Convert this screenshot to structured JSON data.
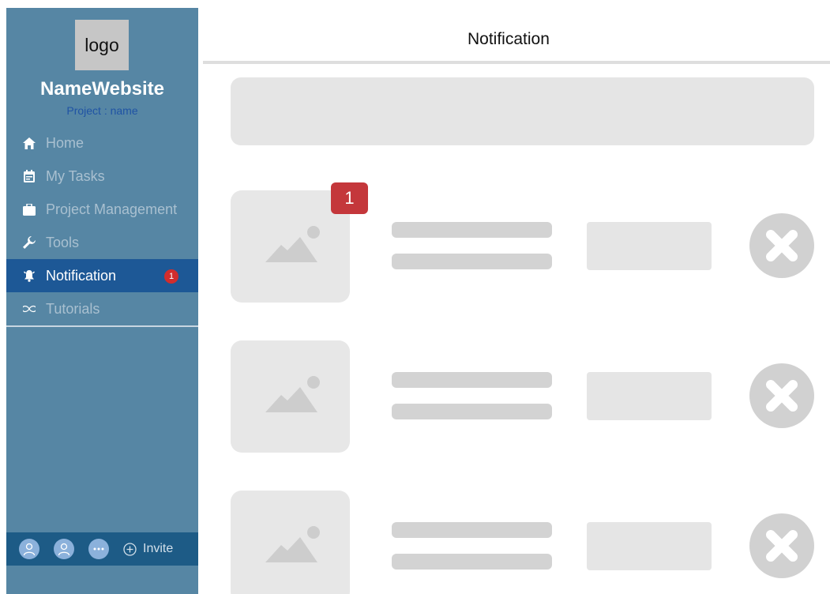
{
  "sidebar": {
    "logo_text": "logo",
    "site_name": "NameWebsite",
    "project_label": "Project : name",
    "nav": [
      {
        "label": "Home",
        "icon": "home-icon"
      },
      {
        "label": "My Tasks",
        "icon": "calendar-icon"
      },
      {
        "label": "Project Management",
        "icon": "briefcase-icon"
      },
      {
        "label": "Tools",
        "icon": "wrench-icon"
      },
      {
        "label": "Notification",
        "icon": "bell-icon",
        "badge": "1",
        "active": true
      },
      {
        "label": "Tutorials",
        "icon": "infinity-icon"
      }
    ],
    "invite": {
      "label": "Invite",
      "avatars": [
        "user-avatar-icon",
        "user-avatar-icon",
        "more-icon"
      ]
    }
  },
  "main": {
    "title": "Notification",
    "notifications": [
      {
        "badge": "1"
      },
      {},
      {}
    ]
  },
  "colors": {
    "sidebar_bg": "#5686a4",
    "active_item": "#1d5896",
    "invite_bar": "#1d5b86",
    "badge_red": "#c4373b",
    "placeholder": "#e5e5e5"
  }
}
